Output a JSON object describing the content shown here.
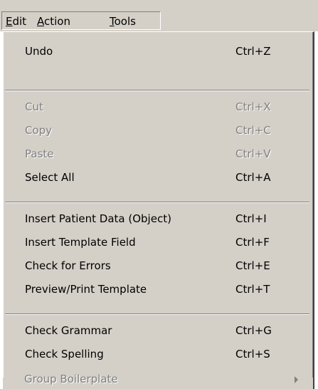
{
  "menubar": {
    "items": [
      {
        "label_mnemonic": "E",
        "label_rest": "dit"
      },
      {
        "label_mnemonic": "A",
        "label_rest": "ction"
      },
      {
        "label_mnemonic": "T",
        "label_rest": "ools"
      }
    ]
  },
  "menu": {
    "items": [
      {
        "label": "Undo",
        "shortcut": "Ctrl+Z",
        "enabled": true
      },
      {
        "label": "Cut",
        "shortcut": "Ctrl+X",
        "enabled": false
      },
      {
        "label": "Copy",
        "shortcut": "Ctrl+C",
        "enabled": false
      },
      {
        "label": "Paste",
        "shortcut": "Ctrl+V",
        "enabled": false
      },
      {
        "label": "Select All",
        "shortcut": "Ctrl+A",
        "enabled": true
      },
      {
        "label": "Insert Patient Data (Object)",
        "shortcut": "Ctrl+I",
        "enabled": true
      },
      {
        "label": "Insert Template Field",
        "shortcut": "Ctrl+F",
        "enabled": true
      },
      {
        "label": "Check for Errors",
        "shortcut": "Ctrl+E",
        "enabled": true
      },
      {
        "label": "Preview/Print Template",
        "shortcut": "Ctrl+T",
        "enabled": true
      },
      {
        "label": "Check Grammar",
        "shortcut": "Ctrl+G",
        "enabled": true
      },
      {
        "label": "Check Spelling",
        "shortcut": "Ctrl+S",
        "enabled": true
      },
      {
        "label": "Group Boilerplate",
        "shortcut": "",
        "enabled": false,
        "submenu": true
      }
    ]
  },
  "colors": {
    "menu_bg": "#d4d0c8",
    "disabled_text": "#808080",
    "text": "#000000"
  }
}
